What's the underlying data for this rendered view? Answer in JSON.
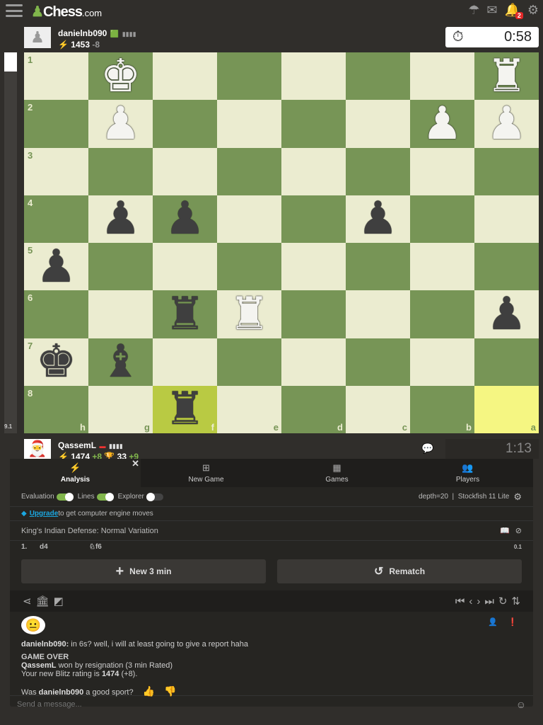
{
  "header": {
    "logo": "Chess",
    "logo_suffix": ".com",
    "notifications": "2"
  },
  "top_player": {
    "name": "danielnb090",
    "rating": "1453",
    "delta": "-8",
    "clock": "0:58"
  },
  "bottom_player": {
    "name": "QassemL",
    "rating": "1474",
    "delta": "+8",
    "trophy": "33",
    "trophy_delta": "+9",
    "clock": "1:13"
  },
  "eval": {
    "value": "9.1",
    "white_fraction": 0.05
  },
  "board": {
    "files": [
      "h",
      "g",
      "f",
      "e",
      "d",
      "c",
      "b",
      "a"
    ],
    "ranks": [
      "1",
      "2",
      "3",
      "4",
      "5",
      "6",
      "7",
      "8"
    ],
    "light": "#ebecd0",
    "dark": "#779556",
    "highlights": [
      {
        "sq": "f8",
        "color": "#b9ca43"
      },
      {
        "sq": "a8",
        "color": "#f5f682"
      }
    ],
    "pieces": [
      {
        "sq": "g1",
        "p": "K",
        "c": "w"
      },
      {
        "sq": "a1",
        "p": "R",
        "c": "w"
      },
      {
        "sq": "g2",
        "p": "P",
        "c": "w"
      },
      {
        "sq": "b2",
        "p": "P",
        "c": "w"
      },
      {
        "sq": "a2",
        "p": "P",
        "c": "w"
      },
      {
        "sq": "g4",
        "p": "P",
        "c": "b"
      },
      {
        "sq": "f4",
        "p": "P",
        "c": "b"
      },
      {
        "sq": "c4",
        "p": "P",
        "c": "b"
      },
      {
        "sq": "h5",
        "p": "P",
        "c": "b"
      },
      {
        "sq": "f6",
        "p": "R",
        "c": "b"
      },
      {
        "sq": "e6",
        "p": "R",
        "c": "w"
      },
      {
        "sq": "a6",
        "p": "P",
        "c": "b"
      },
      {
        "sq": "h7",
        "p": "K",
        "c": "b"
      },
      {
        "sq": "g7",
        "p": "B",
        "c": "b"
      },
      {
        "sq": "f8",
        "p": "R",
        "c": "b"
      }
    ]
  },
  "tabs": [
    {
      "label": "Analysis",
      "icon": "⚡"
    },
    {
      "label": "New Game",
      "icon": "⊞"
    },
    {
      "label": "Games",
      "icon": "▦"
    },
    {
      "label": "Players",
      "icon": "👥"
    }
  ],
  "analysis": {
    "evaluation": "Evaluation",
    "lines": "Lines",
    "explorer": "Explorer",
    "engine": "depth=20  |  Stockfish 11 Lite",
    "upgrade_link": "Upgrade",
    "upgrade_text": " to get computer engine moves",
    "opening": "King's Indian Defense: Normal Variation",
    "move_no": "1.",
    "white_move": "d4",
    "black_move": "f6",
    "move_eval": "0.1"
  },
  "buttons": {
    "new_game": "New 3 min",
    "rematch": "Rematch"
  },
  "chat": {
    "sender": "danielnb090:",
    "message": " in 6s? well, i will at least going to give a report haha",
    "game_over": "GAME OVER",
    "winner": "QassemL",
    "result": " won by resignation (3 min Rated)",
    "rating_prefix": "Your new Blitz rating is ",
    "new_rating": "1474",
    "rating_suffix": " (+8).",
    "sport_prefix": "Was ",
    "sport_name": "danielnb090",
    "sport_suffix": " a good sport?",
    "placeholder": "Send a message..."
  }
}
